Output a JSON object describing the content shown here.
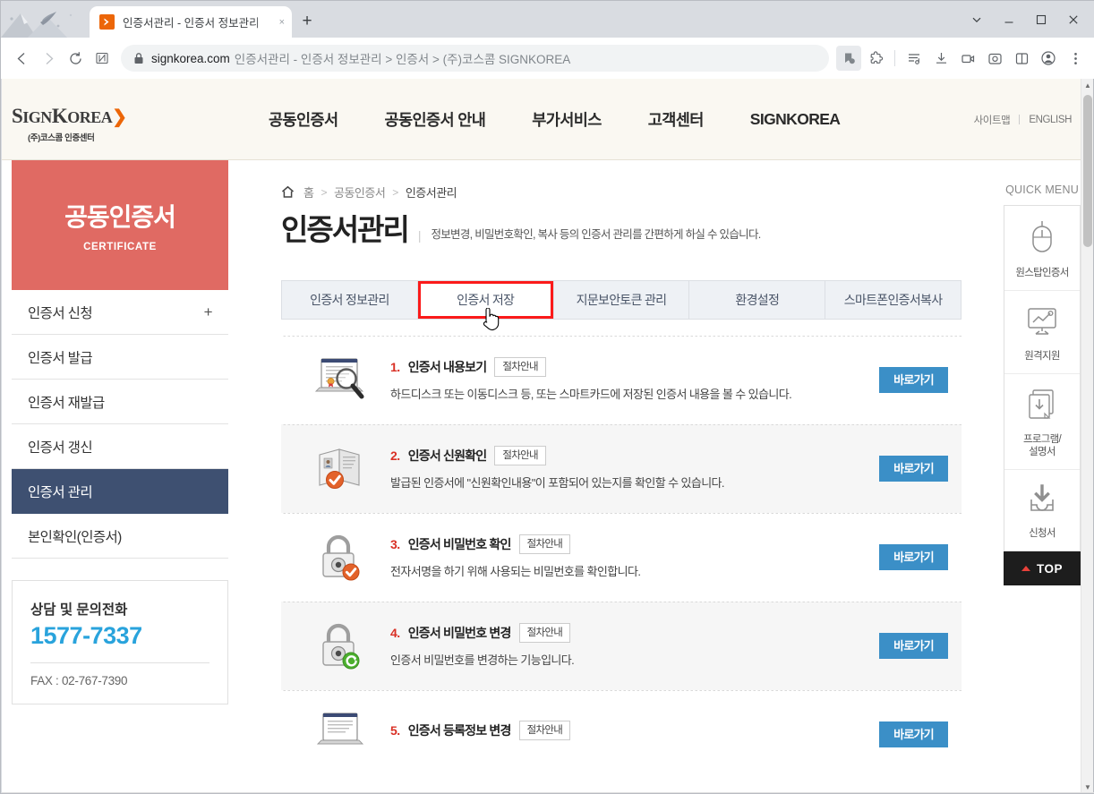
{
  "browser": {
    "tab": {
      "title": "인증서관리 - 인증서 정보관리",
      "favicon": "signkorea-favicon-icon",
      "close": "×"
    },
    "newtab_label": "+",
    "window": {
      "minimize": "minimize-icon",
      "maximize": "maximize-icon",
      "close": "close-icon",
      "tabsearch": "chevron-down-icon"
    },
    "omnibox": {
      "domain": "signkorea.com",
      "rest": "인증서관리 - 인증서 정보관리 > 인증서 > (주)코스콤 SIGNKOREA",
      "lock": "lock-icon"
    },
    "nav": {
      "back": "back-arrow-icon",
      "forward": "forward-arrow-icon",
      "reload": "reload-icon",
      "split": "split-screen-icon"
    },
    "toolbar_icons": [
      "collections-icon",
      "extensions-icon",
      "reading-list-icon",
      "downloads-icon",
      "screen-record-icon",
      "screenshot-icon",
      "split-view-icon",
      "profile-icon",
      "more-menu-icon"
    ]
  },
  "site": {
    "logo": {
      "part1": "S",
      "part2": "IGN",
      "part3": "K",
      "part4": "OREA",
      "arrow": "❯",
      "sub": "(주)코스콤 인증센터"
    },
    "gnb": [
      {
        "label": "공동인증서"
      },
      {
        "label": "공동인증서 안내"
      },
      {
        "label": "부가서비스"
      },
      {
        "label": "고객센터"
      },
      {
        "label": "SIGNKOREA"
      }
    ],
    "util": [
      {
        "label": "사이트맵"
      },
      {
        "label": "ENGLISH"
      }
    ]
  },
  "sidebar": {
    "hero_title": "공동인증서",
    "hero_sub": "CERTIFICATE",
    "items": [
      {
        "label": "인증서 신청",
        "expand": "+",
        "active": false
      },
      {
        "label": "인증서 발급",
        "expand": "",
        "active": false
      },
      {
        "label": "인증서 재발급",
        "expand": "",
        "active": false
      },
      {
        "label": "인증서 갱신",
        "expand": "",
        "active": false
      },
      {
        "label": "인증서 관리",
        "expand": "",
        "active": true
      },
      {
        "label": "본인확인(인증서)",
        "expand": "",
        "active": false
      }
    ],
    "contact": {
      "label": "상담 및 문의전화",
      "phone": "1577-7337",
      "fax": "FAX : 02-767-7390"
    }
  },
  "main": {
    "breadcrumb": {
      "home_icon": "home-icon",
      "items": [
        "홈",
        "공동인증서",
        "인증서관리"
      ],
      "separator": ">"
    },
    "title": "인증서관리",
    "desc_sep": "|",
    "description": "정보변경, 비밀번호확인, 복사 등의 인증서 관리를 간편하게 하실 수 있습니다.",
    "tabs": [
      {
        "label": "인증서 정보관리",
        "selected": false,
        "highlighted": false
      },
      {
        "label": "인증서 저장",
        "selected": true,
        "highlighted": true
      },
      {
        "label": "지문보안토큰 관리",
        "selected": false,
        "highlighted": false
      },
      {
        "label": "환경설정",
        "selected": false,
        "highlighted": false
      },
      {
        "label": "스마트폰인증서복사",
        "selected": false,
        "highlighted": false
      }
    ],
    "guide_label": "절차안내",
    "go_label": "바로가기",
    "rows": [
      {
        "num": "1.",
        "title": "인증서 내용보기",
        "desc": "하드디스크 또는 이동디스크 등, 또는 스마트카드에 저장된 인증서 내용을 볼 수 있습니다.",
        "icon": "certificate-viewer-icon",
        "shaded": false
      },
      {
        "num": "2.",
        "title": "인증서 신원확인",
        "desc": "발급된 인증서에 \"신원확인내용\"이 포함되어 있는지를 확인할 수 있습니다.",
        "icon": "id-book-check-icon",
        "shaded": true
      },
      {
        "num": "3.",
        "title": "인증서 비밀번호 확인",
        "desc": "전자서명을 하기 위해 사용되는 비밀번호를 확인합니다.",
        "icon": "lock-check-icon",
        "shaded": false
      },
      {
        "num": "4.",
        "title": "인증서 비밀번호 변경",
        "desc": "인증서 비밀번호를 변경하는 기능입니다.",
        "icon": "lock-refresh-icon",
        "shaded": true
      },
      {
        "num": "5.",
        "title": "인증서 등록정보 변경",
        "desc": "",
        "icon": "certificate-edit-icon",
        "shaded": false
      }
    ]
  },
  "quick": {
    "title": "QUICK MENU",
    "items": [
      {
        "label": "원스탑인증서",
        "icon": "mouse-icon"
      },
      {
        "label": "원격지원",
        "icon": "remote-monitor-icon"
      },
      {
        "label": "프로그램/\n설명서",
        "icon": "documents-download-icon"
      },
      {
        "label": "신청서",
        "icon": "download-tray-icon"
      }
    ],
    "top_label": "TOP"
  },
  "colors": {
    "brand_orange": "#ec6608",
    "hero_red": "#e06a63",
    "active_navy": "#3e5071",
    "cta_blue": "#3b8fc7",
    "phone_blue": "#29a3dc",
    "highlight_red": "#fb1a1a"
  }
}
